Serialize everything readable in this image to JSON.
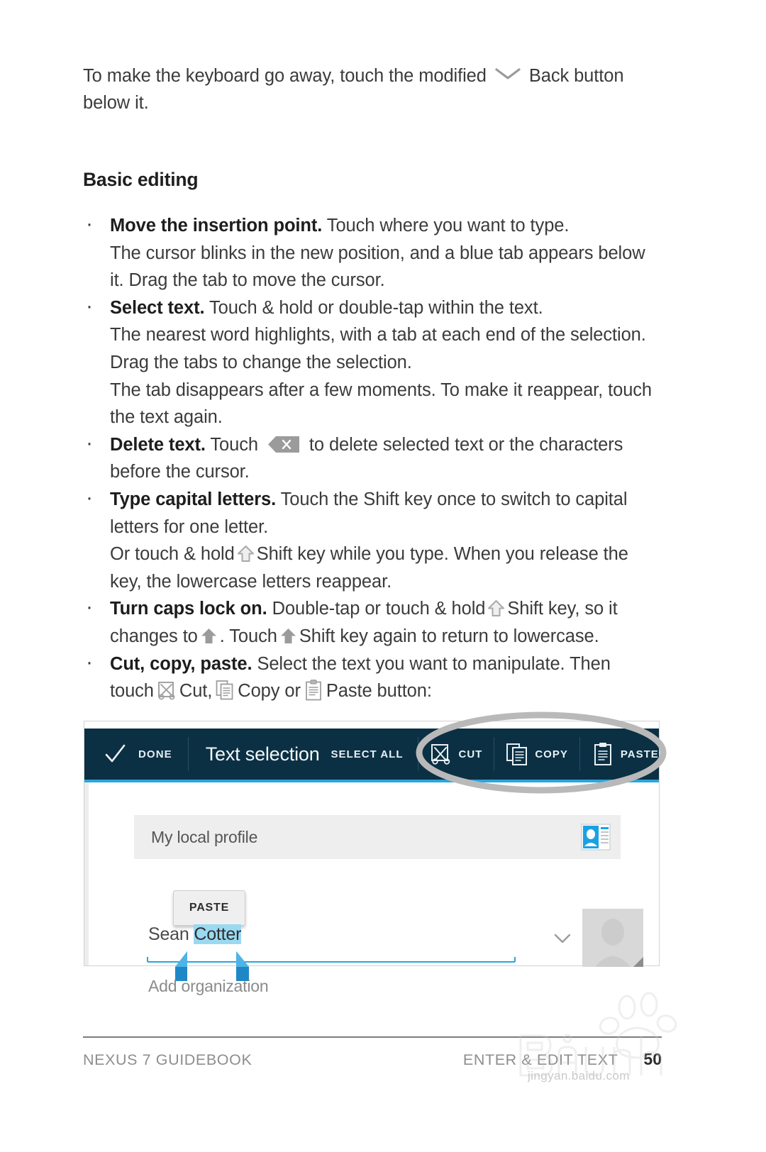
{
  "document": {
    "intro_paragraph": "To make the keyboard go away, touch the modified  Back button below it.",
    "intro_before_icon": "To make the keyboard go away, touch the modified",
    "intro_after_icon": "Back button below it.",
    "section_title": "Basic editing"
  },
  "bullets": [
    {
      "lead": "Move the insertion point.",
      "rest": " Touch where you want to type.",
      "sublines": [
        "The cursor blinks in the new position, and a blue tab appears below it. Drag the tab to move the cursor."
      ]
    },
    {
      "lead": "Select text.",
      "rest": " Touch & hold or double-tap within the text.",
      "sublines": [
        "The nearest word highlights, with a tab at each end of the selection. Drag the tabs to change the selection.",
        "The tab disappears after a few moments. To make it reappear, touch the text again."
      ]
    },
    {
      "lead": "Delete text.",
      "rest_before_icon": " Touch ",
      "icon": "backspace-icon",
      "rest_after_icon": " to delete selected text or the characters before the cursor.",
      "sublines": []
    },
    {
      "lead": "Type capital letters.",
      "rest": " Touch the Shift key once to switch to capital letters for one letter.",
      "subline_before_icon": "Or touch & hold",
      "subline_icon": "shift-outline-icon",
      "subline_after_icon": "Shift key while you type. When you release the key, the lowercase letters reappear."
    },
    {
      "lead": "Turn caps lock on.",
      "rest_before_icon": " Double-tap or touch & hold",
      "icon": "shift-outline-icon",
      "rest_mid": "Shift key, so it changes to",
      "icon2": "shift-filled-icon",
      "rest_mid2": ". Touch",
      "icon3": "shift-filled-icon",
      "rest_after_icon": "Shift key again to return to lowercase."
    },
    {
      "lead": "Cut, copy, paste.",
      "rest": " Select the text you want to manipulate. Then",
      "touch_word": "touch",
      "cut_icon": "cut-icon",
      "cut_label": "Cut,",
      "copy_icon": "copy-icon",
      "copy_label": "Copy or",
      "paste_icon": "paste-icon",
      "paste_label": "Paste button:"
    }
  ],
  "figure": {
    "action_bar": {
      "done_label": "DONE",
      "title": "Text selection",
      "select_all_label": "SELECT ALL",
      "cut_label": "CUT",
      "copy_label": "COPY",
      "paste_label": "PASTE",
      "bar_color": "#0b3044",
      "accent_color": "#2aa5dd"
    },
    "screen": {
      "profile_header": "My local profile",
      "paste_popup_label": "PASTE",
      "name_unselected": "Sean ",
      "name_selected": "Cotter",
      "selection_color": "#9ad9f2",
      "add_organization": "Add organization"
    }
  },
  "footer": {
    "left": "NEXUS 7 GUIDEBOOK",
    "middle": "ENTER & EDIT TEXT",
    "page": "50"
  },
  "watermark": {
    "text": "Baidu",
    "sub": "jingyan.baidu.com"
  }
}
